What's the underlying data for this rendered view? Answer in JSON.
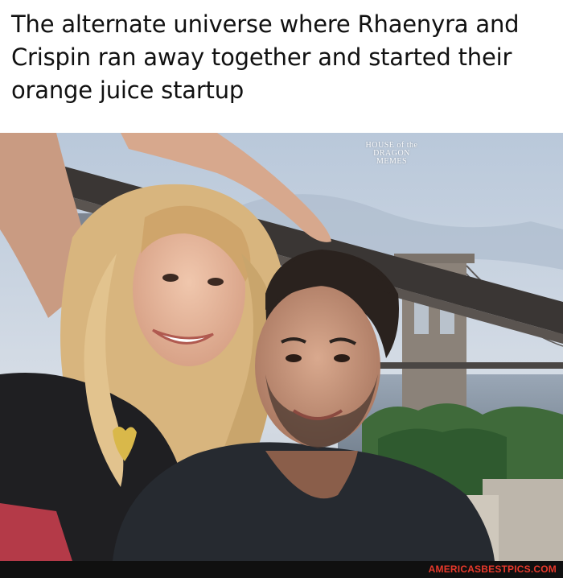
{
  "caption": "The alternate universe where Rhaenyra and\nCrispin ran away together and started their\norange juice startup",
  "watermark": {
    "line1": "HOUSE of the",
    "line2": "DRAGON",
    "line3": "MEMES"
  },
  "footer": {
    "site": "AMERICASBESTPICS.COM"
  },
  "colors": {
    "sky": "#c9d4e2",
    "skyDusk": "#9fb0c6",
    "railing": "#3a3634",
    "hairBlonde": "#d8b57e",
    "hairDark": "#2a221e",
    "skin": "#e4b69a",
    "shirtDark": "#262a30",
    "bridgeStone": "#8a8078",
    "trees": "#3f6a3a",
    "footerText": "#e8392b"
  }
}
